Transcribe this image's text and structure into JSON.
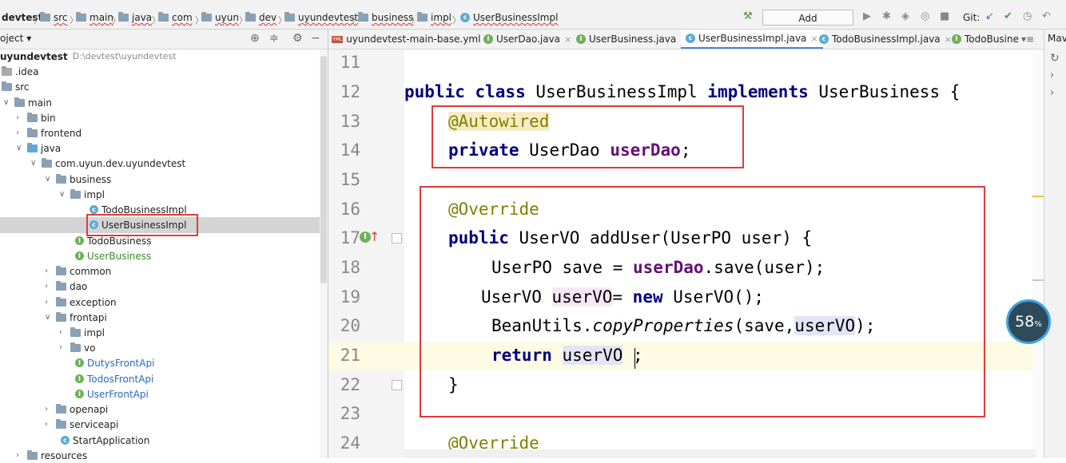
{
  "breadcrumb": {
    "project": "devtest",
    "items": [
      "src",
      "main",
      "java",
      "com",
      "uyun",
      "dev",
      "uyundevtest",
      "business",
      "impl"
    ],
    "file": "UserBusinessImpl"
  },
  "toolbar": {
    "add_config_label": "Add Configuration...",
    "git_label": "Git:"
  },
  "project_panel": {
    "header": "oject",
    "root_name": "uyundevtest",
    "root_path": "D:\\devtest\\uyundevtest",
    "tree": [
      {
        "label": ".idea",
        "kind": "folder"
      },
      {
        "label": "src",
        "kind": "folder"
      },
      {
        "label": "main",
        "kind": "folder"
      },
      {
        "label": "bin",
        "kind": "folder"
      },
      {
        "label": "frontend",
        "kind": "folder"
      },
      {
        "label": "java",
        "kind": "folder"
      },
      {
        "label": "com.uyun.dev.uyundevtest",
        "kind": "package"
      },
      {
        "label": "business",
        "kind": "package"
      },
      {
        "label": "impl",
        "kind": "package"
      },
      {
        "label": "TodoBusinessImpl",
        "kind": "class"
      },
      {
        "label": "UserBusinessImpl",
        "kind": "class"
      },
      {
        "label": "TodoBusiness",
        "kind": "interface"
      },
      {
        "label": "UserBusiness",
        "kind": "interface"
      },
      {
        "label": "common",
        "kind": "package"
      },
      {
        "label": "dao",
        "kind": "package"
      },
      {
        "label": "exception",
        "kind": "package"
      },
      {
        "label": "frontapi",
        "kind": "package"
      },
      {
        "label": "impl",
        "kind": "package"
      },
      {
        "label": "vo",
        "kind": "package"
      },
      {
        "label": "DutysFrontApi",
        "kind": "interface"
      },
      {
        "label": "TodosFrontApi",
        "kind": "interface"
      },
      {
        "label": "UserFrontApi",
        "kind": "interface"
      },
      {
        "label": "openapi",
        "kind": "package"
      },
      {
        "label": "serviceapi",
        "kind": "package"
      },
      {
        "label": "StartApplication",
        "kind": "class"
      },
      {
        "label": "resources",
        "kind": "folder"
      }
    ]
  },
  "editor_tabs": [
    {
      "label": "uyundevtest-main-base.yml"
    },
    {
      "label": "UserDao.java"
    },
    {
      "label": "UserBusiness.java"
    },
    {
      "label": "UserBusinessImpl.java",
      "active": true
    },
    {
      "label": "TodoBusinessImpl.java"
    },
    {
      "label": "TodoBusine"
    }
  ],
  "right_panel_label": "Mav",
  "line_numbers": [
    "11",
    "12",
    "13",
    "14",
    "15",
    "16",
    "17",
    "18",
    "19",
    "20",
    "21",
    "22",
    "23",
    "24"
  ],
  "code": {
    "l12": {
      "kw1": "public class",
      "name": " UserBusinessImpl ",
      "kw2": "implements",
      "rest": " UserBusiness {"
    },
    "l13": {
      "ann": "@Autowired"
    },
    "l14": {
      "kw": "private",
      "type": " UserDao ",
      "field": "userDao",
      "end": ";"
    },
    "l16": {
      "ann": "@Override"
    },
    "l17": {
      "kw": "public",
      "rest": " UserVO addUser(UserPO user) {"
    },
    "l18": {
      "pre": "UserPO save = ",
      "field": "userDao",
      "post": ".save(user);"
    },
    "l19": {
      "pre": "UserVO ",
      "var": "userVO",
      "mid": "= ",
      "kw": "new",
      "post": " UserVO();"
    },
    "l20": {
      "pre": "BeanUtils.",
      "method": "copyProperties",
      "args": "(save,",
      "var": "userVO",
      "end": ");"
    },
    "l21": {
      "kw": "return",
      "var": "userVO",
      "end": " ;"
    },
    "l22": {
      "brace": "}"
    },
    "l24": {
      "ann": "@Override"
    }
  },
  "badge": {
    "value": "58",
    "unit": "%"
  },
  "colors": {
    "keyword": "#000080",
    "annotation": "#808000",
    "field": "#660e7a",
    "highlight_box": "#e03a3a"
  }
}
